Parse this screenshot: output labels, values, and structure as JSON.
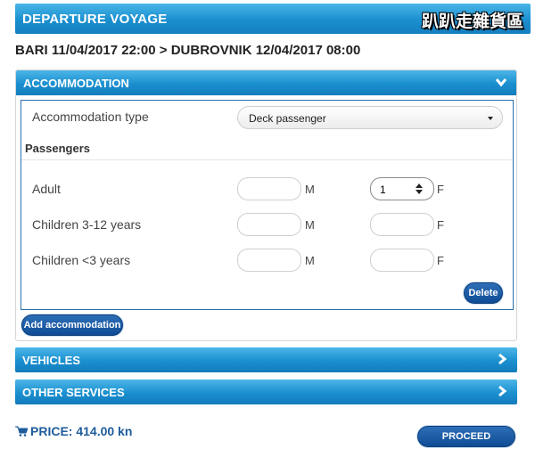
{
  "header": {
    "title": "DEPARTURE VOYAGE",
    "watermark": "趴趴走雜貨區"
  },
  "route": "BARI 11/04/2017 22:00 > DUBROVNIK 12/04/2017 08:00",
  "accommodation": {
    "section_label": "ACCOMMODATION",
    "type_label": "Accommodation type",
    "type_value": "Deck passenger",
    "passengers_title": "Passengers",
    "rows": [
      {
        "label": "Adult",
        "male_value": "",
        "male_suffix": "M",
        "female_value": "1",
        "female_suffix": "F"
      },
      {
        "label": "Children 3-12 years",
        "male_value": "",
        "male_suffix": "M",
        "female_value": "",
        "female_suffix": "F"
      },
      {
        "label": "Children <3 years",
        "male_value": "",
        "male_suffix": "M",
        "female_value": "",
        "female_suffix": "F"
      }
    ],
    "delete_label": "Delete",
    "add_label": "Add accommodation"
  },
  "vehicles": {
    "label": "VEHICLES"
  },
  "other_services": {
    "label": "OTHER SERVICES"
  },
  "footer": {
    "price_label": "PRICE: 414.00 kn",
    "proceed_label": "PROCEED"
  },
  "colors": {
    "header_blue": "#1a8fcf",
    "button_blue": "#0f4c95",
    "price_blue": "#1e5c9c"
  }
}
